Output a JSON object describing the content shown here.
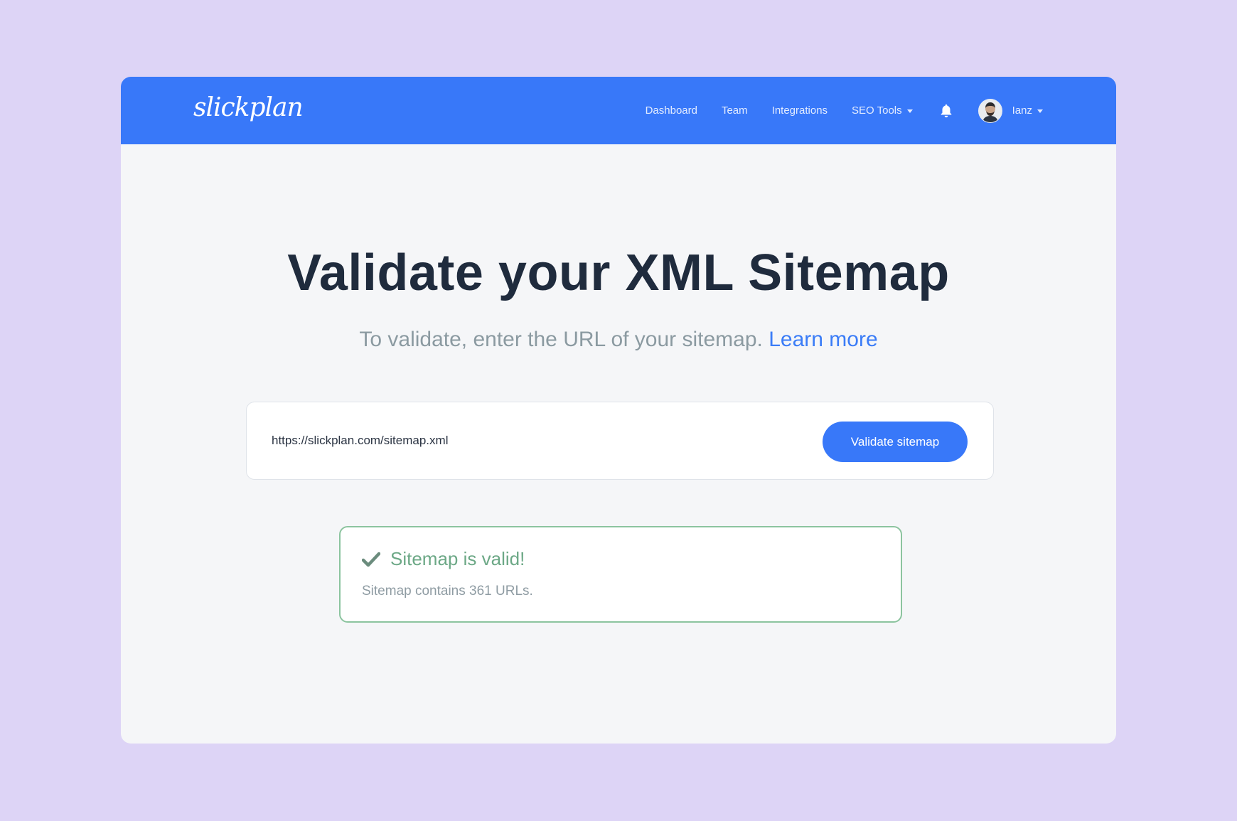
{
  "nav": {
    "logo": "slickplan",
    "links": {
      "dashboard": "Dashboard",
      "team": "Team",
      "integrations": "Integrations",
      "seo_tools": "SEO Tools"
    },
    "user_name": "Ianz"
  },
  "main": {
    "title": "Validate your XML Sitemap",
    "subtitle": "To validate, enter the URL of your sitemap.",
    "learn_more": "Learn more"
  },
  "search": {
    "value": "https://slickplan.com/sitemap.xml",
    "button_label": "Validate sitemap"
  },
  "result": {
    "title": "Sitemap is valid!",
    "detail": "Sitemap contains 361 URLs."
  },
  "colors": {
    "background": "#ddd4f6",
    "brand": "#3878f9",
    "success": "#6ca886"
  }
}
